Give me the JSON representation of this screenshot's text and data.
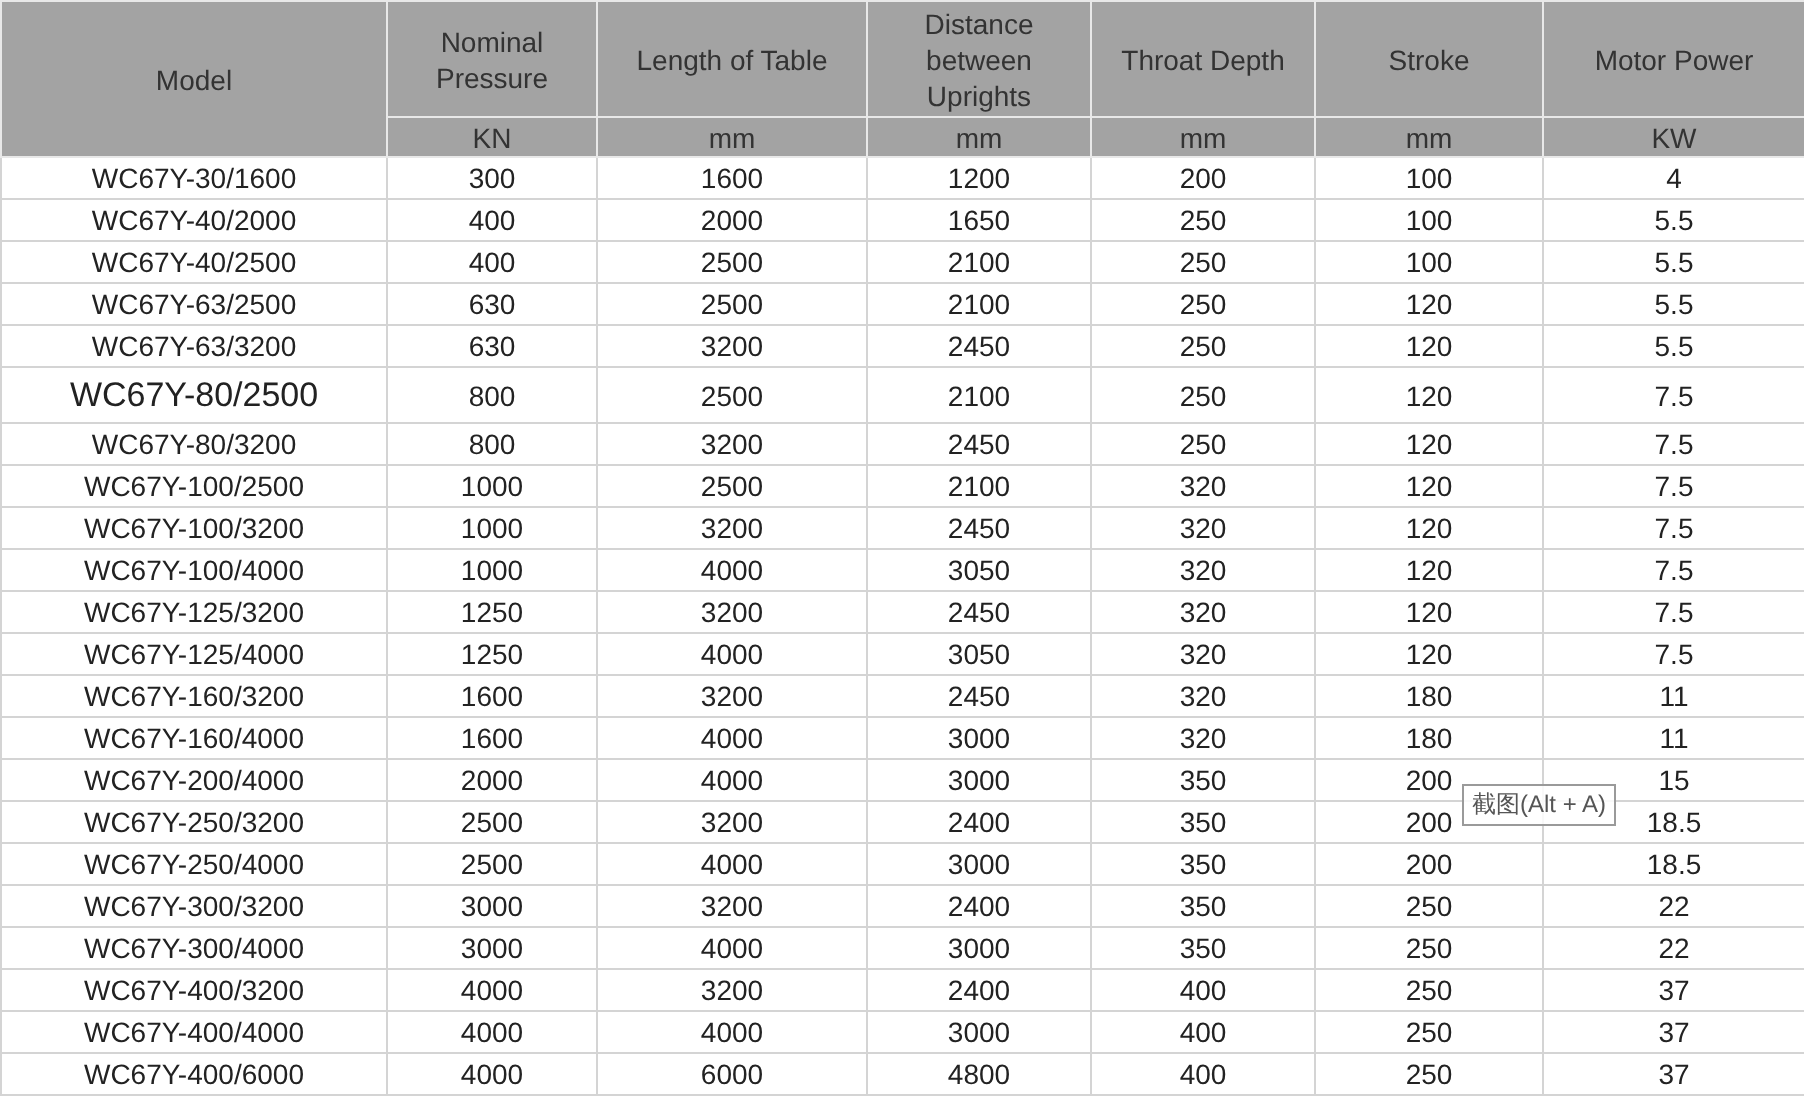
{
  "columns": [
    {
      "label": "Model"
    },
    {
      "label": "Nominal Pressure",
      "unit": "KN"
    },
    {
      "label": "Length of Table",
      "unit": "mm"
    },
    {
      "label": "Distance between Uprights",
      "unit": "mm"
    },
    {
      "label": "Throat Depth",
      "unit": "mm"
    },
    {
      "label": "Stroke",
      "unit": "mm"
    },
    {
      "label": "Motor Power",
      "unit": "KW"
    }
  ],
  "rows": [
    {
      "large": false,
      "cells": [
        "WC67Y-30/1600",
        "300",
        "1600",
        "1200",
        "200",
        "100",
        "4"
      ]
    },
    {
      "large": false,
      "cells": [
        "WC67Y-40/2000",
        "400",
        "2000",
        "1650",
        "250",
        "100",
        "5.5"
      ]
    },
    {
      "large": false,
      "cells": [
        "WC67Y-40/2500",
        "400",
        "2500",
        "2100",
        "250",
        "100",
        "5.5"
      ]
    },
    {
      "large": false,
      "cells": [
        "WC67Y-63/2500",
        "630",
        "2500",
        "2100",
        "250",
        "120",
        "5.5"
      ]
    },
    {
      "large": false,
      "cells": [
        "WC67Y-63/3200",
        "630",
        "3200",
        "2450",
        "250",
        "120",
        "5.5"
      ]
    },
    {
      "large": true,
      "cells": [
        "WC67Y-80/2500",
        "800",
        "2500",
        "2100",
        "250",
        "120",
        "7.5"
      ]
    },
    {
      "large": false,
      "cells": [
        "WC67Y-80/3200",
        "800",
        "3200",
        "2450",
        "250",
        "120",
        "7.5"
      ]
    },
    {
      "large": false,
      "cells": [
        "WC67Y-100/2500",
        "1000",
        "2500",
        "2100",
        "320",
        "120",
        "7.5"
      ]
    },
    {
      "large": false,
      "cells": [
        "WC67Y-100/3200",
        "1000",
        "3200",
        "2450",
        "320",
        "120",
        "7.5"
      ]
    },
    {
      "large": false,
      "cells": [
        "WC67Y-100/4000",
        "1000",
        "4000",
        "3050",
        "320",
        "120",
        "7.5"
      ]
    },
    {
      "large": false,
      "cells": [
        "WC67Y-125/3200",
        "1250",
        "3200",
        "2450",
        "320",
        "120",
        "7.5"
      ]
    },
    {
      "large": false,
      "cells": [
        "WC67Y-125/4000",
        "1250",
        "4000",
        "3050",
        "320",
        "120",
        "7.5"
      ]
    },
    {
      "large": false,
      "cells": [
        "WC67Y-160/3200",
        "1600",
        "3200",
        "2450",
        "320",
        "180",
        "11"
      ]
    },
    {
      "large": false,
      "cells": [
        "WC67Y-160/4000",
        "1600",
        "4000",
        "3000",
        "320",
        "180",
        "11"
      ]
    },
    {
      "large": false,
      "cells": [
        "WC67Y-200/4000",
        "2000",
        "4000",
        "3000",
        "350",
        "200",
        "15"
      ]
    },
    {
      "large": false,
      "cells": [
        "WC67Y-250/3200",
        "2500",
        "3200",
        "2400",
        "350",
        "200",
        "18.5"
      ]
    },
    {
      "large": false,
      "cells": [
        "WC67Y-250/4000",
        "2500",
        "4000",
        "3000",
        "350",
        "200",
        "18.5"
      ]
    },
    {
      "large": false,
      "cells": [
        "WC67Y-300/3200",
        "3000",
        "3200",
        "2400",
        "350",
        "250",
        "22"
      ]
    },
    {
      "large": false,
      "cells": [
        "WC67Y-300/4000",
        "3000",
        "4000",
        "3000",
        "350",
        "250",
        "22"
      ]
    },
    {
      "large": false,
      "cells": [
        "WC67Y-400/3200",
        "4000",
        "3200",
        "2400",
        "400",
        "250",
        "37"
      ]
    },
    {
      "large": false,
      "cells": [
        "WC67Y-400/4000",
        "4000",
        "4000",
        "3000",
        "400",
        "250",
        "37"
      ]
    },
    {
      "large": false,
      "cells": [
        "WC67Y-400/6000",
        "4000",
        "6000",
        "4800",
        "400",
        "250",
        "37"
      ]
    }
  ],
  "tooltip": {
    "text": "截图(Alt + A)"
  }
}
